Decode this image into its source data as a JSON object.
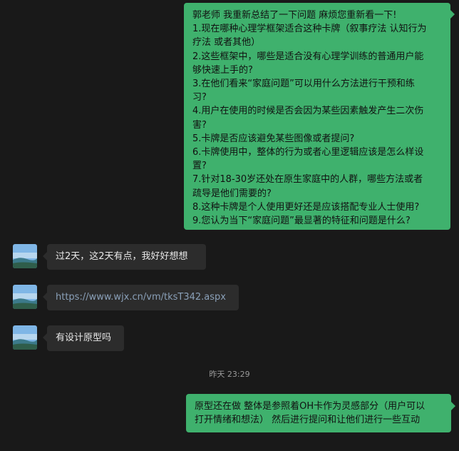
{
  "messages": {
    "m1": {
      "lines": [
        "郭老师 我重新总结了一下问题 麻烦您重新看一下!",
        "1.现在哪种心理学框架适合这种卡牌（叙事疗法 认知行为",
        "疗法 或者其他）",
        "2.这些框架中，哪些是适合没有心理学训练的普通用户能",
        "够快速上手的?",
        "3.在他们看来“家庭问题”可以用什么方法进行干预和练",
        "习?",
        "4.用户在使用的时候是否会因为某些因素触发产生二次伤",
        "害?",
        "5.卡牌是否应该避免某些图像或者提问?",
        "6.卡牌使用中，整体的行为或者心里逻辑应该是怎么样设",
        "置?",
        "7.针对18-30岁还处在原生家庭中的人群，哪些方法或者",
        "疏导是他们需要的?",
        "8.这种卡牌是个人使用更好还是应该搭配专业人士使用?",
        "9.您认为当下“家庭问题”最显著的特征和问题是什么?"
      ]
    },
    "m2": {
      "text": "过2天，这2天有点，我好好想想"
    },
    "m3": {
      "text": "https://www.wjx.cn/vm/tksT342.aspx"
    },
    "m4": {
      "text": "有设计原型吗"
    },
    "timestamp": "昨天 23:29",
    "m5": {
      "lines": [
        "原型还在做 整体是参照着OH卡作为灵感部分（用户可以",
        "打开情绪和想法） 然后进行提问和让他们进行一些互动"
      ]
    }
  },
  "colors": {
    "outgoing_bubble": "#3fb16d",
    "incoming_bubble": "#2c2c2c",
    "background": "#191919"
  },
  "icons": {
    "contact_avatar": "landscape-avatar-icon"
  }
}
